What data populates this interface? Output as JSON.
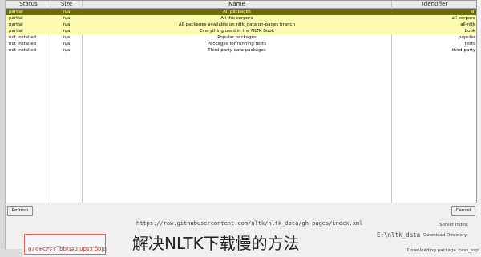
{
  "columns": {
    "identifier": "Identifier",
    "name": "Name",
    "size": "Size",
    "status": "Status"
  },
  "rows": [
    {
      "id": "all",
      "name": "All packages",
      "size": "n/a",
      "status": "partial",
      "style": "selected"
    },
    {
      "id": "all-corpora",
      "name": "All the corpora",
      "size": "n/a",
      "status": "partial",
      "style": "highlight"
    },
    {
      "id": "all-nltk",
      "name": "All packages available on nltk_data gh-pages branch",
      "size": "n/a",
      "status": "partial",
      "style": "highlight"
    },
    {
      "id": "book",
      "name": "Everything used in the NLTK Book",
      "size": "n/a",
      "status": "partial",
      "style": "highlight"
    },
    {
      "id": "popular",
      "name": "Popular packages",
      "size": "n/a",
      "status": "not installed",
      "style": "normal"
    },
    {
      "id": "tests",
      "name": "Packages for running tests",
      "size": "n/a",
      "status": "not installed",
      "style": "normal"
    },
    {
      "id": "third-party",
      "name": "Third-party data packages",
      "size": "n/a",
      "status": "not installed",
      "style": "normal"
    }
  ],
  "buttons": {
    "cancel": "Cancel",
    "refresh": "Refresh"
  },
  "server": {
    "label": "Server Index:",
    "url": "https://raw.githubusercontent.com/nltk/nltk_data/gh-pages/index.xml"
  },
  "download_dir": {
    "label": "Download Directory:",
    "value": "E:\\nltk_data"
  },
  "progress_text": "Downloading package 'cess_esp'",
  "caption": "解决NLTK下载慢的方法",
  "watermark": "blog.csdn.net/qq_33254670"
}
